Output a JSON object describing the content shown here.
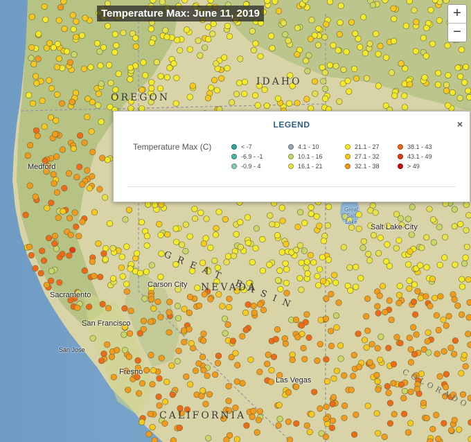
{
  "map": {
    "title": "Temperature Max: June 11, 2019",
    "zoom_in_label": "+",
    "zoom_out_label": "−",
    "region_labels": [
      "OREGON",
      "IDAHO",
      "NEVADA",
      "GREAT BASIN",
      "CALIFORNIA",
      "COLORADO"
    ],
    "city_labels": [
      "Carson City",
      "Sacramento",
      "San Francisco",
      "San Jose",
      "Fresno",
      "Las Vegas",
      "Great Salt Lake",
      "Salt Lake City",
      "Medford"
    ]
  },
  "legend": {
    "title": "LEGEND",
    "close_label": "×",
    "variable_label": "Temperature Max (C)",
    "items": [
      {
        "label": "< -7",
        "color": "#2fa9a0"
      },
      {
        "label": "-6.9 - -1",
        "color": "#46b8a8"
      },
      {
        "label": "-0.9 - 4",
        "color": "#7fcfbf"
      },
      {
        "label": "4.1 - 10",
        "color": "#9aa7b0"
      },
      {
        "label": "10.1 - 16",
        "color": "#c8d66a"
      },
      {
        "label": "16.1 - 21",
        "color": "#e6e14a"
      },
      {
        "label": "21.1 - 27",
        "color": "#f4ea2a"
      },
      {
        "label": "27.1 - 32",
        "color": "#f7c81e"
      },
      {
        "label": "32.1 - 38",
        "color": "#f29a1c"
      },
      {
        "label": "38.1 - 43",
        "color": "#ee6a16"
      },
      {
        "label": "43.1 - 49",
        "color": "#e53a14"
      },
      {
        "label": "> 49",
        "color": "#c81010"
      }
    ]
  }
}
